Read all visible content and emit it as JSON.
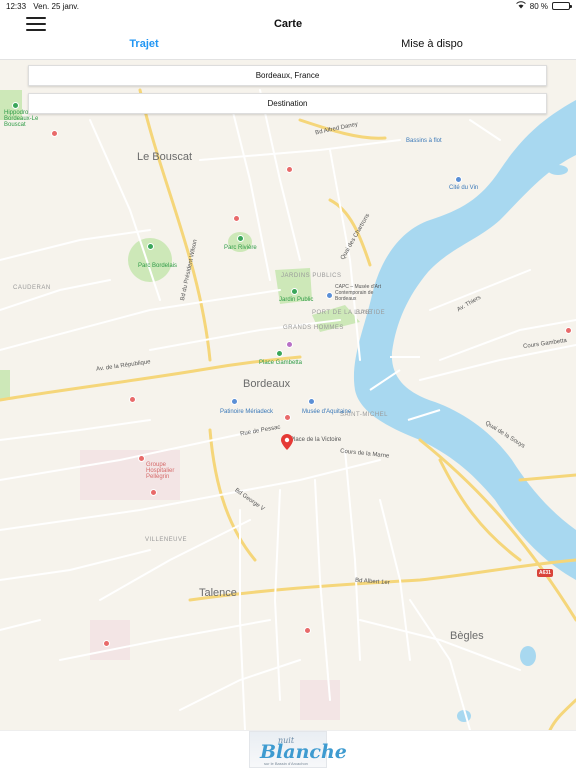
{
  "status_bar": {
    "time": "12:33",
    "date": "Ven. 25 janv.",
    "battery": "80 %",
    "battery_level": 0.8
  },
  "header": {
    "title": "Carte",
    "menu_icon": "hamburger-menu-icon"
  },
  "tabs": [
    {
      "label": "Trajet",
      "active": true
    },
    {
      "label": "Mise à dispo",
      "active": false
    }
  ],
  "search": {
    "origin_value": "Bordeaux, France",
    "destination_placeholder": "Destination"
  },
  "map": {
    "labels": [
      "Le Bouscat",
      "Bordeaux",
      "Talence",
      "Bègles",
      "CAUDERAN",
      "VILLENEUVE",
      "SAINT-MICHEL",
      "GRANDS HOMMES",
      "JARDINS PUBLICS",
      "PORT DE LA LUNE",
      "BASTIDE",
      "Parc Bordelais",
      "Parc Rivière",
      "Jardin Public",
      "Place Gambetta",
      "Patinoire Mériadeck",
      "Musée d'Aquitaine",
      "CAPC – Musée d'Art Contemporain de Bordeaux",
      "Place de la Victoire",
      "Groupe Hospitalier Pellegrin",
      "Hippodrome Bordeaux-Le Bouscat",
      "Quai des Chartrons",
      "Bd Alfred Daney",
      "Bd du Président Wilson",
      "Bd George V",
      "Bd Albert 1er",
      "Cours Gambetta",
      "Quai de la Souys",
      "Av. de la République",
      "Av. Thiers",
      "Cité du Vin",
      "Bassins à flot",
      "Rue de Pessac",
      "Cours de la Marne",
      "A631"
    ],
    "colors": {
      "land": "#f6f3ec",
      "water": "#a8d8f0",
      "park": "#cde8b8",
      "major_road": "#f5d67a",
      "minor_road": "#ffffff",
      "pin": "#e53935"
    }
  },
  "footer": {
    "logo_small": "nuit",
    "logo_big": "Blanche",
    "logo_sub": "sur le Bassin d'Arcachon"
  }
}
